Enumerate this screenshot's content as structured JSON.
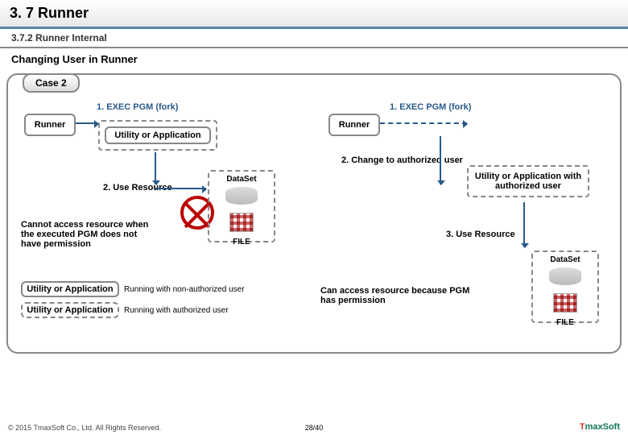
{
  "header": {
    "title": "3. 7 Runner",
    "subtitle": "3.7.2 Runner Internal",
    "changing": "Changing User in Runner"
  },
  "case": {
    "tab": "Case 2",
    "runner": "Runner",
    "fork": "1. EXEC PGM (fork)",
    "utility": "Utility or Application",
    "use_resource": "2. Use Resource",
    "change_auth": "2. Change to authorized user",
    "auth_util": "Utility or Application with authorized user",
    "use_resource3": "3. Use Resource",
    "cannot": "Cannot access resource when the executed PGM does not have permission",
    "can": "Can access resource because PGM has permission",
    "dataset": "DataSet",
    "file": "FILE"
  },
  "legend": {
    "nonauth": "Running with non-authorized user",
    "auth": "Running with authorized user"
  },
  "footer": {
    "copyright": "© 2015 TmaxSoft Co., Ltd. All Rights Reserved.",
    "page": "28/40",
    "logo_t": "T",
    "logo_max": "maxSoft"
  }
}
